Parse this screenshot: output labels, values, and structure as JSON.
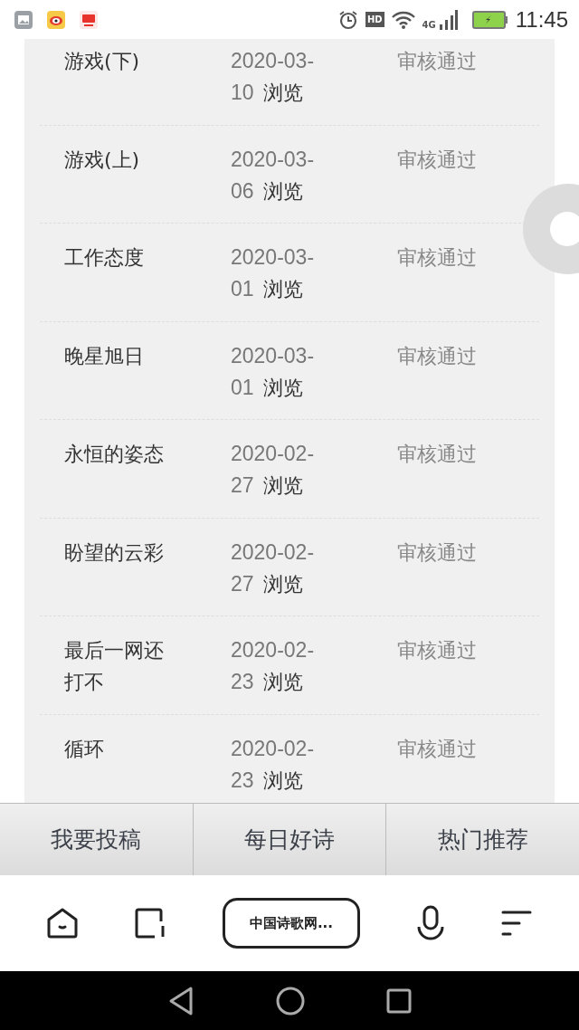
{
  "status_bar": {
    "network": "4G",
    "hd": "HD",
    "time": "11:45"
  },
  "rows": [
    {
      "title": "游戏(下)",
      "date": "2020-03-10",
      "action": "浏览",
      "status": "审核通过"
    },
    {
      "title": "游戏(上)",
      "date": "2020-03-06",
      "action": "浏览",
      "status": "审核通过"
    },
    {
      "title": "工作态度",
      "date": "2020-03-01",
      "action": "浏览",
      "status": "审核通过"
    },
    {
      "title": "晚星旭日",
      "date": "2020-03-01",
      "action": "浏览",
      "status": "审核通过"
    },
    {
      "title": "永恒的姿态",
      "date": "2020-02-27",
      "action": "浏览",
      "status": "审核通过"
    },
    {
      "title": "盼望的云彩",
      "date": "2020-02-27",
      "action": "浏览",
      "status": "审核通过"
    },
    {
      "title": "最后一网还打不",
      "date": "2020-02-23",
      "action": "浏览",
      "status": "审核通过"
    },
    {
      "title": "循环",
      "date": "2020-02-23",
      "action": "浏览",
      "status": "审核通过"
    }
  ],
  "tabs": [
    {
      "label": "我要投稿"
    },
    {
      "label": "每日好诗"
    },
    {
      "label": "热门推荐"
    }
  ],
  "address_bar": {
    "text": "中国诗歌网..."
  }
}
